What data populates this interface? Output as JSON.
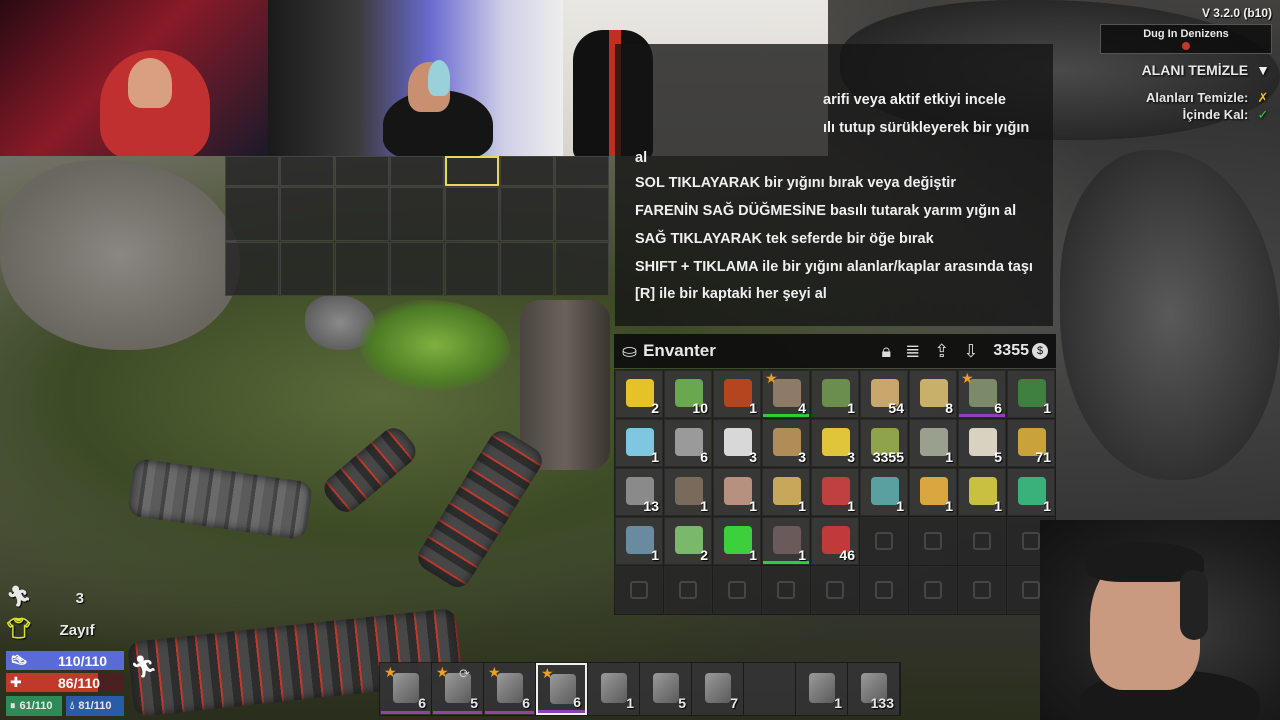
{
  "hud": {
    "version": "V 3.2.0 (b10)",
    "event_name": "Dug In Denizens",
    "quest_title": "ALANI TEMİZLE",
    "quest_lines": [
      {
        "label": "Alanları Temizle:",
        "icon": "cross-mark-icon",
        "icon_glyph": "✗",
        "color": "#f0c020"
      },
      {
        "label": "İçinde Kal:",
        "icon": "check-mark-icon",
        "icon_glyph": "✓",
        "color": "#2ecc40"
      }
    ]
  },
  "tooltip": {
    "lines": [
      "arifi veya aktif etkiyi incele",
      "ılı tutup sürükleyerek bir yığın",
      "al",
      "SOL TIKLAYARAK bir yığını bırak veya değiştir",
      "FARENİN SAĞ DÜĞMESİNE basılı tutarak yarım yığın al",
      "SAĞ TIKLAYARAK tek seferde bir öğe bırak",
      "SHIFT + TIKLAMA ile bir yığını alanlar/kaplar arasında taşı",
      "[R] ile bir kaptaki her şeyi al"
    ]
  },
  "inventory": {
    "title": "Envanter",
    "money": "3355",
    "currency_symbol": "$",
    "header_icons": [
      "lock-icon",
      "sort-icon",
      "move-to-container-icon",
      "loot-all-icon"
    ],
    "items": [
      {
        "name": "corn-icon",
        "count": "2",
        "color": "#e6c229"
      },
      {
        "name": "aloe-icon",
        "count": "10",
        "color": "#6aa84f"
      },
      {
        "name": "jar-icon",
        "count": "1",
        "color": "#b5451f"
      },
      {
        "name": "stone-axe-icon",
        "count": "4",
        "color": "#8d7b68",
        "star": true,
        "quality": "green"
      },
      {
        "name": "arrow-bundle-icon",
        "count": "1",
        "color": "#6b8e4e"
      },
      {
        "name": "wood-planks-icon",
        "count": "54",
        "color": "#c9a66b"
      },
      {
        "name": "ammo-round-icon",
        "count": "8",
        "color": "#c8b06a"
      },
      {
        "name": "wrench-tool-icon",
        "count": "6",
        "color": "#7d8a6a",
        "star": true,
        "quality": "purple"
      },
      {
        "name": "canned-food-icon",
        "count": "1",
        "color": "#3f7f3f"
      },
      {
        "name": "water-bottle-icon",
        "count": "1",
        "color": "#7fc6e0"
      },
      {
        "name": "rock-icon",
        "count": "6",
        "color": "#9a9a9a"
      },
      {
        "name": "cotton-pads-icon",
        "count": "3",
        "color": "#d8d8d8"
      },
      {
        "name": "dirt-pile-icon",
        "count": "3",
        "color": "#b08d57"
      },
      {
        "name": "goldenrod-plant-icon",
        "count": "3",
        "color": "#e0c43a"
      },
      {
        "name": "casino-coin-icon",
        "count": "3355",
        "color": "#8fa34a"
      },
      {
        "name": "schematic-book-icon",
        "count": "1",
        "color": "#9aa08e"
      },
      {
        "name": "bone-icon",
        "count": "5",
        "color": "#d8d2c0"
      },
      {
        "name": "brass-scrap-icon",
        "count": "71",
        "color": "#c9a23a"
      },
      {
        "name": "tongs-icon",
        "count": "13",
        "color": "#8a8a8a"
      },
      {
        "name": "magazine-icon",
        "count": "1",
        "color": "#7a6a5a"
      },
      {
        "name": "animal-hide-icon",
        "count": "1",
        "color": "#b89080"
      },
      {
        "name": "syringe-icon",
        "count": "1",
        "color": "#c7a85a"
      },
      {
        "name": "food-box-icon",
        "count": "1",
        "color": "#c04040"
      },
      {
        "name": "tin-can-icon",
        "count": "1",
        "color": "#5aa0a0"
      },
      {
        "name": "beer-mug-icon",
        "count": "1",
        "color": "#d9a640"
      },
      {
        "name": "canned-corn-icon",
        "count": "1",
        "color": "#c8c040"
      },
      {
        "name": "mason-jar-icon",
        "count": "1",
        "color": "#3ab07a"
      },
      {
        "name": "book-icon",
        "count": "1",
        "color": "#6a8aa0"
      },
      {
        "name": "herb-bundle-icon",
        "count": "2",
        "color": "#7ab86a"
      },
      {
        "name": "pills-icon",
        "count": "1",
        "color": "#3cd03c"
      },
      {
        "name": "raw-meat-icon",
        "count": "1",
        "color": "#6a5a5a",
        "quality": "green"
      },
      {
        "name": "gas-can-icon",
        "count": "46",
        "color": "#c03a3a"
      },
      {
        "name": "",
        "count": ""
      },
      {
        "name": "",
        "count": ""
      },
      {
        "name": "",
        "count": ""
      },
      {
        "name": "",
        "count": ""
      },
      {
        "name": "",
        "count": ""
      },
      {
        "name": "",
        "count": ""
      },
      {
        "name": "",
        "count": ""
      },
      {
        "name": "",
        "count": ""
      },
      {
        "name": "",
        "count": ""
      },
      {
        "name": "",
        "count": ""
      },
      {
        "name": "",
        "count": ""
      },
      {
        "name": "",
        "count": ""
      },
      {
        "name": "",
        "count": ""
      }
    ]
  },
  "player": {
    "level_count": "3",
    "condition_label": "Zayıf",
    "stamina": "110/110",
    "health": "86/110",
    "health_fraction": 0.78,
    "food": "61/110",
    "water": "81/110"
  },
  "hotbar": [
    {
      "name": "hotbar-pistol-icon",
      "count": "6",
      "star": true,
      "active": false
    },
    {
      "name": "hotbar-pipe-rifle-icon",
      "count": "5",
      "star": true,
      "active": false,
      "mod": "⟳"
    },
    {
      "name": "hotbar-club-icon",
      "count": "6",
      "star": true,
      "active": false
    },
    {
      "name": "hotbar-stone-axe-icon",
      "count": "6",
      "star": true,
      "active": true
    },
    {
      "name": "hotbar-spear-icon",
      "count": "1",
      "star": false,
      "active": false
    },
    {
      "name": "hotbar-first-aid-icon",
      "count": "5",
      "star": false,
      "active": false
    },
    {
      "name": "hotbar-torch-icon",
      "count": "7",
      "star": false,
      "active": false
    },
    {
      "name": "",
      "count": "",
      "star": false,
      "active": false
    },
    {
      "name": "hotbar-bottle-icon",
      "count": "1",
      "star": false,
      "active": false
    },
    {
      "name": "hotbar-ammo-icon",
      "count": "133",
      "star": false,
      "active": false
    }
  ],
  "colors": {
    "accent_yellow": "#f0c020",
    "stamina_blue": "#5a6ad8",
    "health_red": "#c0392b",
    "food_green": "#2e8b57",
    "water_blue": "#2a5aa8"
  }
}
